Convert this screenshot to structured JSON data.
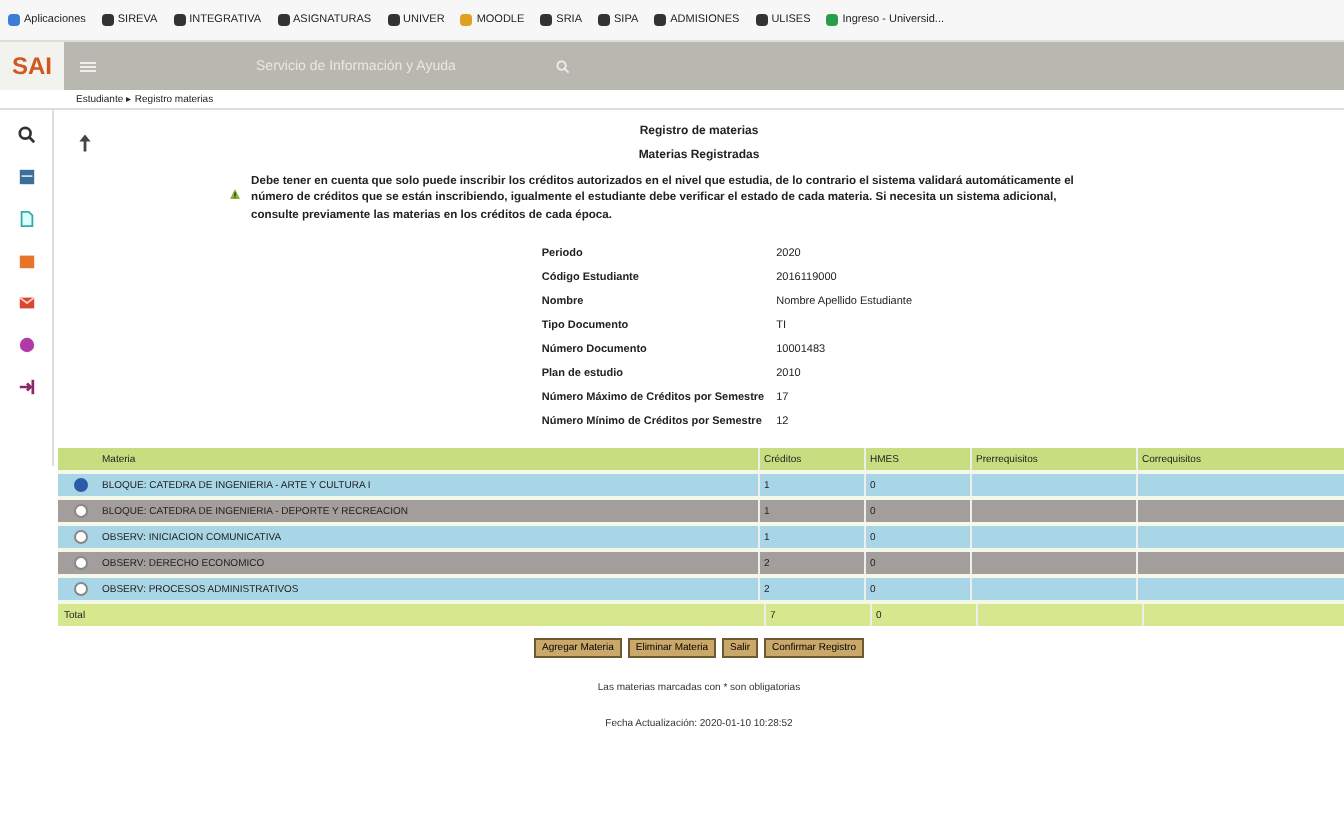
{
  "bookmarks": [
    {
      "label": "Aplicaciones",
      "color": "#3b7dd8"
    },
    {
      "label": "SIREVA",
      "color": "#333333"
    },
    {
      "label": "INTEGRATIVA",
      "color": "#333333"
    },
    {
      "label": "ASIGNATURAS",
      "color": "#333333"
    },
    {
      "label": "UNIVER",
      "color": "#333333"
    },
    {
      "label": "MOODLE",
      "color": "#e0a020"
    },
    {
      "label": "SRIA",
      "color": "#333333"
    },
    {
      "label": "SIPA",
      "color": "#333333"
    },
    {
      "label": "ADMISIONES",
      "color": "#333333"
    },
    {
      "label": "ULISES",
      "color": "#333333"
    },
    {
      "label": "Ingreso - Universid...",
      "color": "#2a9d4a"
    }
  ],
  "header": {
    "logo": "SAI",
    "search_placeholder": "Servicio de Información y Ayuda"
  },
  "breadcrumb": "Estudiante ▸ Registro materias",
  "page": {
    "title": "Registro de materias",
    "subtitle": "Materias Registradas",
    "warning": "Debe tener en cuenta que solo puede inscribir los créditos autorizados en el nivel que estudia, de lo contrario el sistema validará automáticamente el número de créditos que se están inscribiendo, igualmente el estudiante debe verificar el estado de cada materia. Si necesita un sistema adicional, consulte previamente las materias en los créditos de cada época."
  },
  "fields": [
    {
      "label": "Periodo",
      "value": "2020"
    },
    {
      "label": "Código Estudiante",
      "value": "2016119000"
    },
    {
      "label": "Nombre",
      "value": "Nombre Apellido Estudiante"
    },
    {
      "label": "Tipo Documento",
      "value": "TI"
    },
    {
      "label": "Número Documento",
      "value": "10001483"
    },
    {
      "label": "Plan de estudio",
      "value": "2010"
    },
    {
      "label": "Número Máximo de Créditos por Semestre",
      "value": "17"
    },
    {
      "label": "Número Mínimo de Créditos por Semestre",
      "value": "12"
    }
  ],
  "table": {
    "columns": [
      "Materia",
      "Créditos",
      "HMES",
      "Prerrequisitos",
      "Correquisitos"
    ],
    "rows": [
      {
        "selected": true,
        "cells": [
          "BLOQUE: CATEDRA DE INGENIERIA - ARTE Y CULTURA I",
          "1",
          "0"
        ]
      },
      {
        "selected": false,
        "cells": [
          "BLOQUE: CATEDRA DE INGENIERIA - DEPORTE Y RECREACION",
          "1",
          "0"
        ]
      },
      {
        "selected": false,
        "cells": [
          "OBSERV: INICIACION COMUNICATIVA",
          "1",
          "0"
        ]
      },
      {
        "selected": false,
        "cells": [
          "OBSERV: DERECHO ECONOMICO",
          "2",
          "0"
        ]
      },
      {
        "selected": false,
        "cells": [
          "OBSERV: PROCESOS ADMINISTRATIVOS",
          "2",
          "0"
        ]
      }
    ],
    "total": {
      "label": "Total",
      "credits": "7",
      "hmes": "0"
    }
  },
  "buttons": [
    "Agregar Materia",
    "Eliminar Materia",
    "Salir",
    "Confirmar Registro"
  ],
  "footer": [
    "Las materias marcadas con * son obligatorias",
    "Fecha Actualización: 2020-01-10 10:28:52"
  ]
}
